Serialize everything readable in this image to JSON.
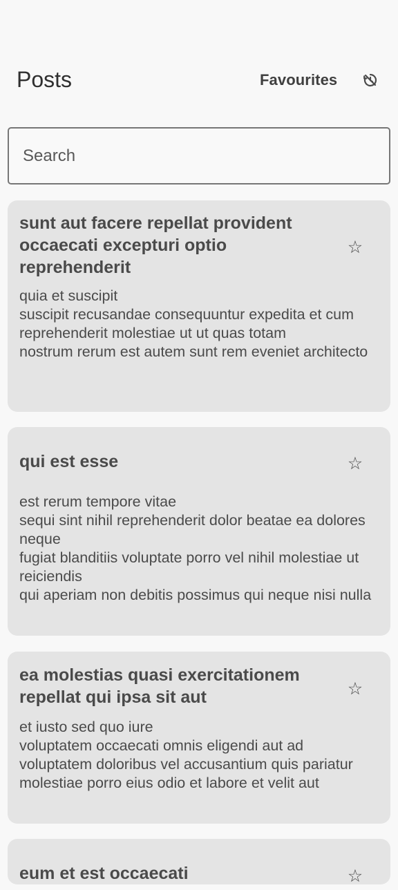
{
  "header": {
    "title": "Posts",
    "favourites_label": "Favourites",
    "history_icon": "history-icon"
  },
  "search": {
    "placeholder": "Search",
    "value": ""
  },
  "posts": [
    {
      "title": "sunt aut facere repellat provident occaecati excepturi optio reprehenderit",
      "body": "quia et suscipit\nsuscipit recusandae consequuntur expedita et cum\nreprehenderit molestiae ut ut quas totam\nnostrum rerum est autem sunt rem eveniet architecto",
      "star_icon": "star-outline-icon"
    },
    {
      "title": "qui est esse",
      "body": "est rerum tempore vitae\nsequi sint nihil reprehenderit dolor beatae ea dolores neque\nfugiat blanditiis voluptate porro vel nihil molestiae ut reiciendis\nqui aperiam non debitis possimus qui neque nisi nulla",
      "star_icon": "star-outline-icon"
    },
    {
      "title": "ea molestias quasi exercitationem repellat qui ipsa sit aut",
      "body": "et iusto sed quo iure\nvoluptatem occaecati omnis eligendi aut ad\nvoluptatem doloribus vel accusantium quis pariatur\nmolestiae porro eius odio et labore et velit aut",
      "star_icon": "star-outline-icon"
    },
    {
      "title": "eum et est occaecati",
      "body": "",
      "star_icon": "star-outline-icon"
    }
  ]
}
